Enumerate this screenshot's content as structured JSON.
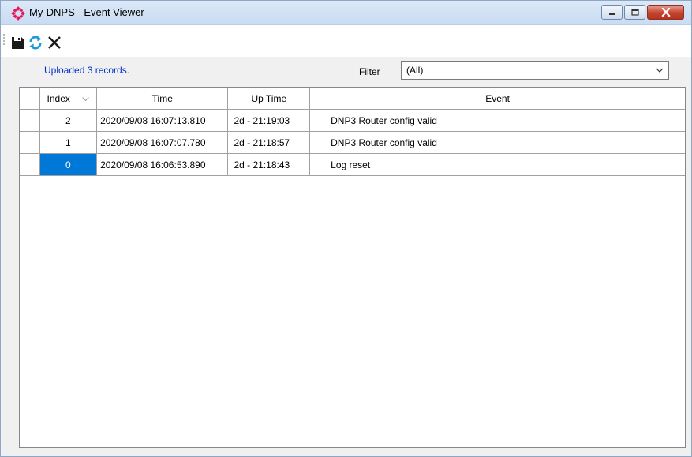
{
  "window": {
    "title": "My-DNPS - Event Viewer",
    "accent_color": "#e8175d",
    "controls": {
      "minimize_icon": "minimize-icon",
      "maximize_icon": "maximize-icon",
      "close_icon": "close-icon"
    }
  },
  "toolbar": {
    "buttons": [
      {
        "icon": "save-icon"
      },
      {
        "icon": "refresh-icon"
      },
      {
        "icon": "delete-icon"
      }
    ]
  },
  "status": {
    "text": "Uploaded 3 records.",
    "color": "#0033cc"
  },
  "filter": {
    "label": "Filter",
    "selected": "(All)"
  },
  "table": {
    "columns": [
      "Index",
      "Time",
      "Up Time",
      "Event"
    ],
    "sort_column": "Index",
    "rows": [
      {
        "index": "2",
        "time": "2020/09/08 16:07:13.810",
        "uptime": "2d - 21:19:03",
        "event": "DNP3 Router config valid"
      },
      {
        "index": "1",
        "time": "2020/09/08 16:07:07.780",
        "uptime": "2d - 21:18:57",
        "event": "DNP3 Router config valid"
      },
      {
        "index": "0",
        "time": "2020/09/08 16:06:53.890",
        "uptime": "2d - 21:18:43",
        "event": "Log reset"
      }
    ],
    "selected_row": 2,
    "selection_color": "#0078d7"
  }
}
